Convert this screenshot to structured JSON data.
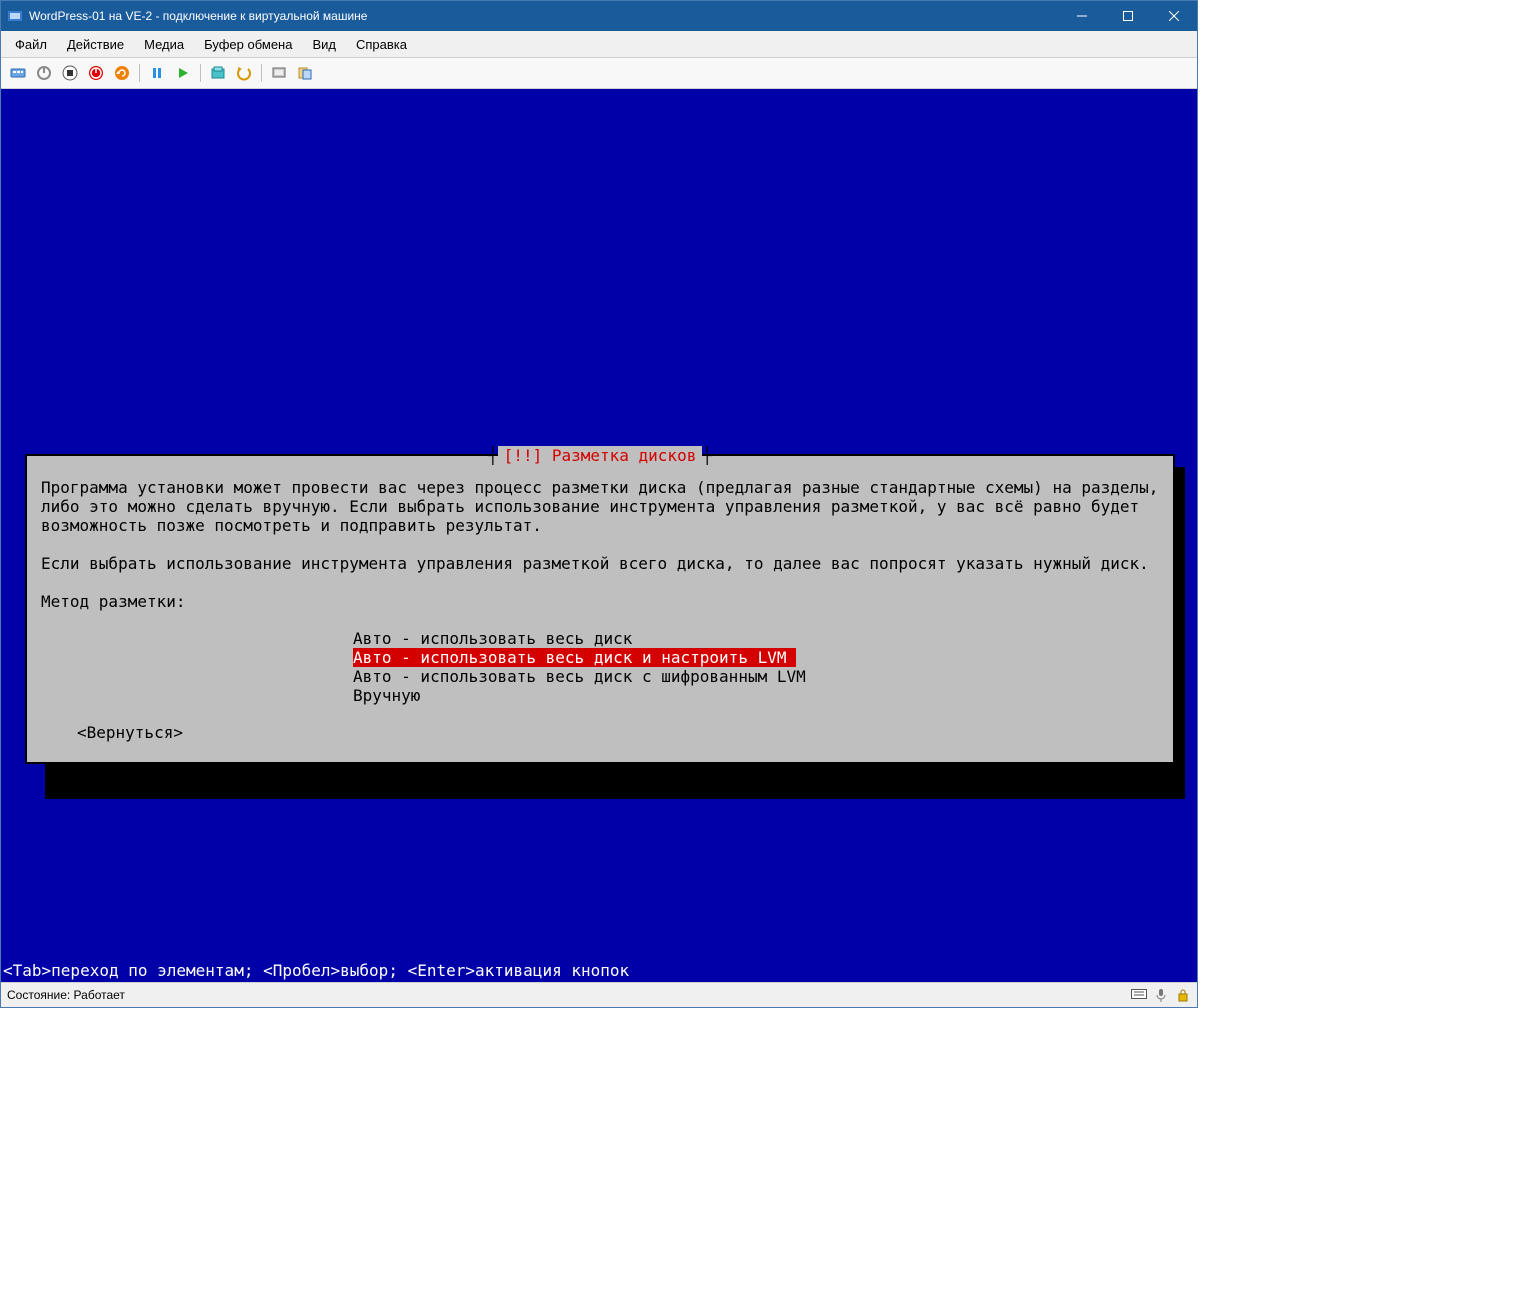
{
  "titlebar": {
    "title": "WordPress-01 на VE-2 - подключение к виртуальной машине"
  },
  "menubar": {
    "items": [
      "Файл",
      "Действие",
      "Медиа",
      "Буфер обмена",
      "Вид",
      "Справка"
    ]
  },
  "toolbar": {
    "icons": [
      "ctrl-alt-del-icon",
      "power-cycle-icon",
      "stop-icon",
      "shutdown-icon",
      "reset-icon",
      "pause-icon",
      "start-icon",
      "checkpoint-icon",
      "revert-icon",
      "enhanced-session-icon",
      "share-icon"
    ]
  },
  "installer": {
    "dialog_title_decor_left": "┤",
    "dialog_title_decor_right": "├",
    "dialog_title": " [!!] Разметка дисков ",
    "paragraph1": "Программа установки может провести вас через процесс разметки диска (предлагая разные стандартные схемы) на разделы,\nлибо это можно сделать вручную. Если выбрать использование инструмента управления разметкой, у вас всё равно будет\nвозможность позже посмотреть и подправить результат.",
    "paragraph2": "Если выбрать использование инструмента управления разметкой всего диска, то далее вас попросят указать нужный диск.",
    "prompt": "Метод разметки:",
    "options": [
      "Авто - использовать весь диск",
      "Авто - использовать весь диск и настроить LVM",
      "Авто - использовать весь диск с шифрованным LVM",
      "Вручную"
    ],
    "selected_index": 1,
    "back_label": "<Вернуться>",
    "hint": "<Tab>переход по элементам; <Пробел>выбор; <Enter>активация кнопок"
  },
  "statusbar": {
    "text": "Состояние: Работает"
  }
}
